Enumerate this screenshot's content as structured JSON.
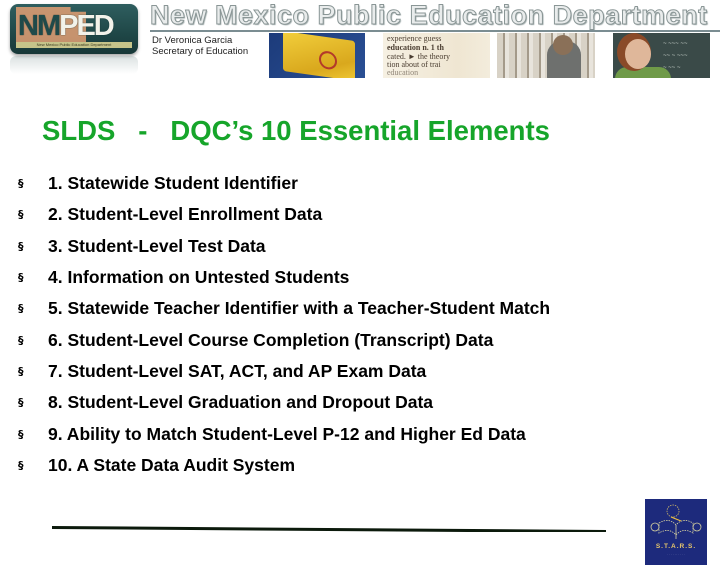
{
  "header": {
    "logo_abbrev_nm": "NM",
    "logo_abbrev_ped": "PED",
    "logo_strip_text": "New Mexico Public Education Department",
    "department_title": "New Mexico Public Education Department",
    "secretary_name": "Dr Veronica Garcia",
    "secretary_role": "Secretary of Education",
    "dictionary_lines": [
      "experience  guess",
      "education n. 1 th",
      "cated. ► the theory",
      "tion about of trai",
      "education"
    ]
  },
  "slide": {
    "title": "SLDS   -   DQC’s 10 Essential Elements",
    "title_color": "#16a52a",
    "bullet_glyph": "§",
    "items": [
      "1. Statewide Student Identifier",
      "2. Student-Level Enrollment Data",
      "3. Student-Level Test Data",
      "4. Information on Untested Students",
      "5. Statewide Teacher Identifier with a Teacher-Student Match",
      "6. Student-Level Course Completion (Transcript) Data",
      "7. Student-Level SAT, ACT, and AP Exam Data",
      "8. Student-Level Graduation and Dropout Data",
      "9. Ability to Match Student-Level P-12 and Higher Ed Data",
      "10. A State Data Audit System"
    ]
  },
  "footer": {
    "stars_logo_text": "S.T.A.R.S."
  }
}
